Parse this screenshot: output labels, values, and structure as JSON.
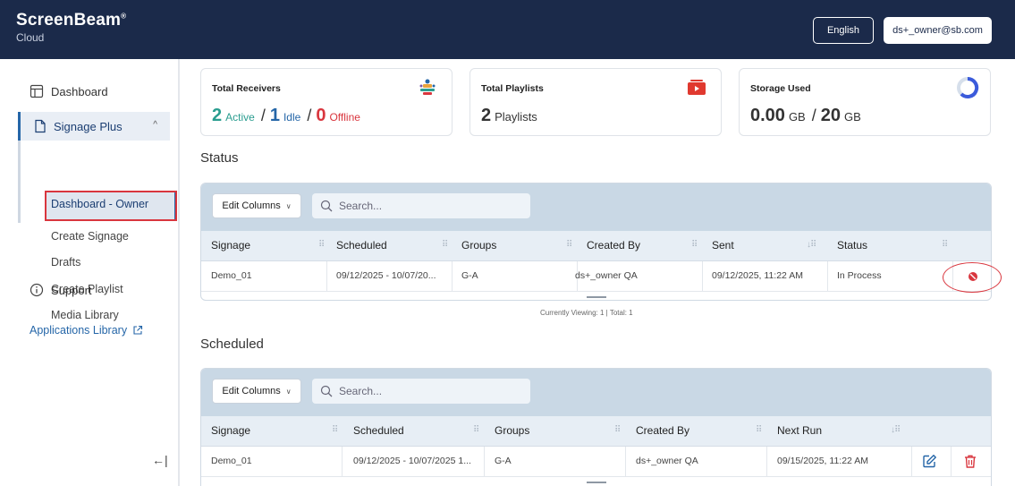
{
  "header": {
    "brand": "ScreenBeam",
    "brand_mark": "®",
    "sub": "Cloud",
    "language": "English",
    "user": "ds+_owner@sb.com"
  },
  "sidebar": {
    "dashboard": "Dashboard",
    "signage_plus": "Signage Plus",
    "sub_items": [
      "Dashboard - Owner",
      "Create Signage",
      "Drafts",
      "Create Playlist",
      "Media Library"
    ],
    "support": "Support",
    "applications_library": "Applications Library",
    "collapse": "←|"
  },
  "cards": {
    "receivers": {
      "title": "Total Receivers",
      "active_count": "2",
      "active_label": "Active",
      "sep1": "/",
      "idle_count": "1",
      "idle_label": "Idle",
      "sep2": "/",
      "offline_count": "0",
      "offline_label": "Offline"
    },
    "playlists": {
      "title": "Total Playlists",
      "count": "2",
      "label": "Playlists"
    },
    "storage": {
      "title": "Storage Used",
      "used": "0.00",
      "used_unit": "GB",
      "sep": "/",
      "total": "20",
      "total_unit": "GB",
      "used_fraction": 0.0
    }
  },
  "status": {
    "title": "Status",
    "edit_columns": "Edit Columns",
    "search_placeholder": "Search...",
    "columns": [
      "Signage",
      "Scheduled",
      "Groups",
      "Created By",
      "Sent",
      "Status"
    ],
    "row": {
      "signage": "Demo_01",
      "scheduled": "09/12/2025 - 10/07/20...",
      "groups": "G-A",
      "created_by": "ds+_owner QA",
      "sent": "09/12/2025, 11:22 AM",
      "status": "In Process"
    },
    "footer": "Currently Viewing: 1  |  Total: 1"
  },
  "scheduled": {
    "title": "Scheduled",
    "edit_columns": "Edit Columns",
    "search_placeholder": "Search...",
    "columns": [
      "Signage",
      "Scheduled",
      "Groups",
      "Created By",
      "Next Run"
    ],
    "row": {
      "signage": "Demo_01",
      "scheduled": "09/12/2025 - 10/07/2025 1...",
      "groups": "G-A",
      "created_by": "ds+_owner QA",
      "next_run": "09/15/2025, 11:22 AM"
    }
  },
  "colors": {
    "header_bg": "#1b2a4a",
    "active": "#2a9d8f",
    "idle": "#2566a8",
    "offline": "#d9363e",
    "highlight": "#d9363e"
  }
}
